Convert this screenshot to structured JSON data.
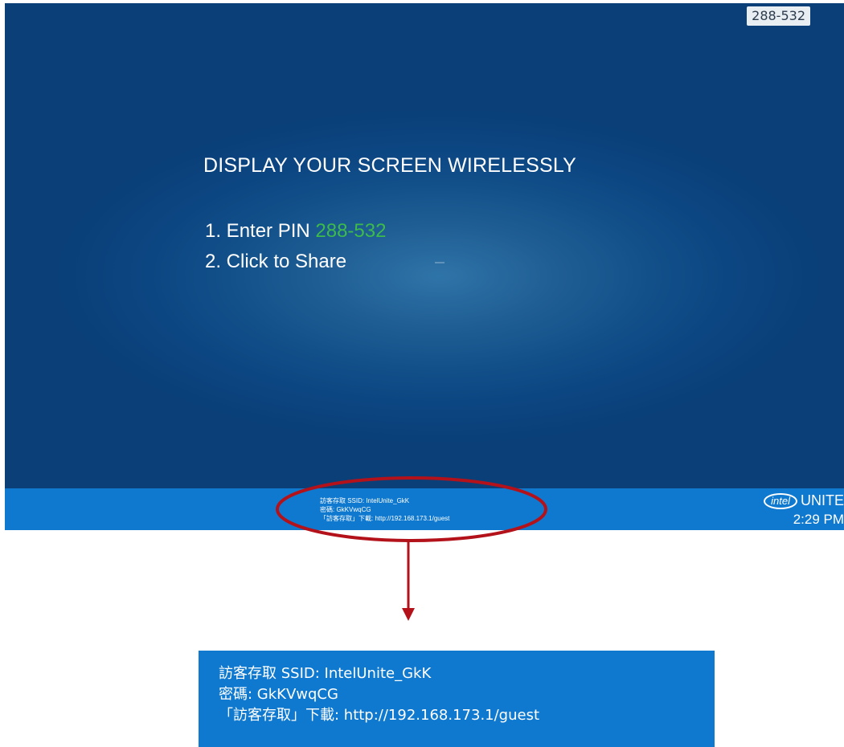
{
  "pin_badge": "288-532",
  "headline": "DISPLAY YOUR SCREEN WIRELESSLY",
  "steps": {
    "step1_prefix": "1. Enter PIN ",
    "step1_pin": "288-532",
    "step2": "2. Click to Share"
  },
  "bottom_bar": {
    "line1": "訪客存取 SSID: IntelUnite_GkK",
    "line2": "密碼: GkKVwqCG",
    "line3": "「訪客存取」下載: http://192.168.173.1/guest",
    "logo_text": "intel",
    "brand": "UNITE",
    "time": "2:29 PM"
  },
  "zoom_panel": {
    "line1": "訪客存取 SSID: IntelUnite_GkK",
    "line2": "密碼: GkKVwqCG",
    "line3": "「訪客存取」下載: http://192.168.173.1/guest"
  },
  "colors": {
    "pin_green": "#3dbb4a",
    "bar_blue": "#0f79cf",
    "annotation_red": "#b3121b"
  },
  "icons": [
    "intel-logo-icon",
    "arrow-down-icon"
  ]
}
